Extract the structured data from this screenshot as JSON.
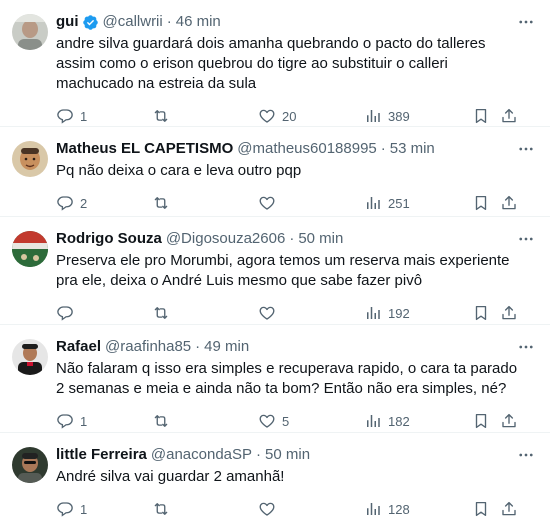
{
  "tweets": [
    {
      "name": "gui",
      "verified": true,
      "handle": "@callwrii",
      "time": "46 min",
      "text": "andre silva guardará dois amanha quebrando o pacto do talleres assim como o erison quebrou do tigre ao substituir o calleri machucado na estreia da sula",
      "replies": "1",
      "retweets": "",
      "likes": "20",
      "views": "389"
    },
    {
      "name": "Matheus EL CAPETISMO",
      "verified": false,
      "handle": "@matheus60188995",
      "time": "53 min",
      "text": "Pq não deixa o cara e leva outro pqp",
      "replies": "2",
      "retweets": "",
      "likes": "",
      "views": "251"
    },
    {
      "name": "Rodrigo Souza",
      "verified": false,
      "handle": "@Digosouza2606",
      "time": "50 min",
      "text": "Preserva ele pro Morumbi, agora temos um reserva mais experiente pra ele, deixa o André Luis mesmo que sabe fazer pivô",
      "replies": "",
      "retweets": "",
      "likes": "",
      "views": "192"
    },
    {
      "name": "Rafael",
      "verified": false,
      "handle": "@raafinha85",
      "time": "49 min",
      "text": "Não falaram q isso era simples e recuperava rapido, o cara ta parado 2 semanas e meia e ainda não ta bom? Então não era simples, né?",
      "replies": "1",
      "retweets": "",
      "likes": "5",
      "views": "182"
    },
    {
      "name": "little Ferreira",
      "verified": false,
      "handle": "@anacondaSP",
      "time": "50 min",
      "text": "André silva vai guardar 2 amanhã!",
      "replies": "1",
      "retweets": "",
      "likes": "",
      "views": "128"
    }
  ],
  "icons": {
    "more": "more-horizontal-icon",
    "reply": "reply-icon",
    "retweet": "retweet-icon",
    "like": "like-icon",
    "views": "views-icon",
    "bookmark": "bookmark-icon",
    "share": "share-icon",
    "verified": "verified-badge-icon"
  },
  "colors": {
    "text": "#0f1419",
    "secondary": "#536471",
    "verified": "#1d9bf0",
    "divider": "#eff3f4"
  }
}
